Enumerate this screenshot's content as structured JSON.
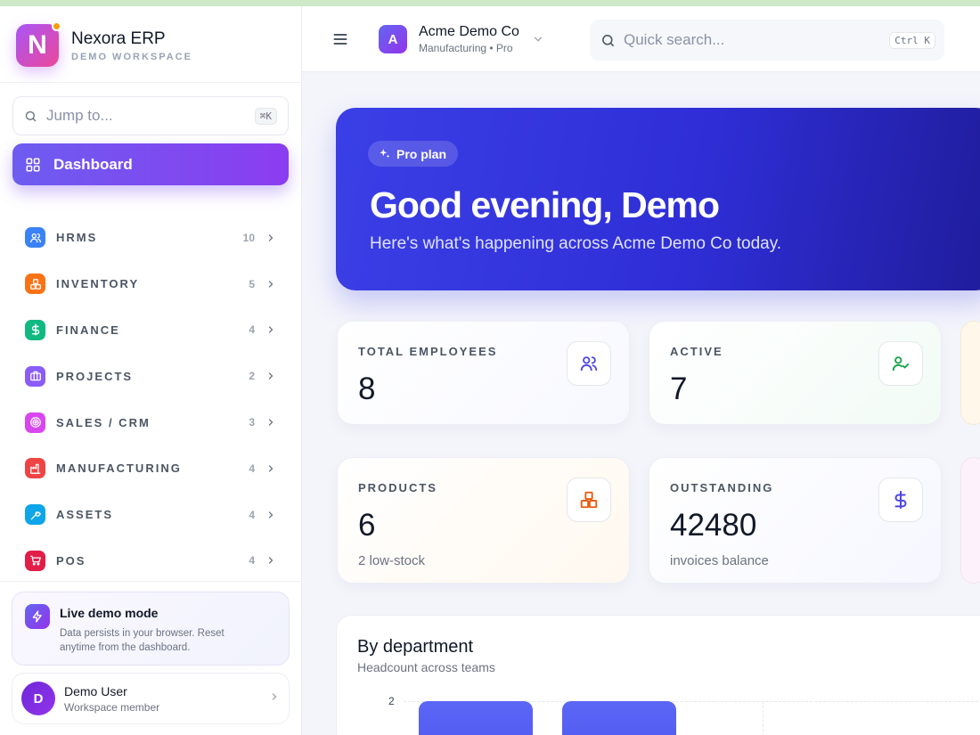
{
  "brand": {
    "name": "Nexora ERP",
    "subtitle": "DEMO WORKSPACE",
    "logo_letter": "N"
  },
  "jump": {
    "placeholder": "Jump to...",
    "shortcut": "⌘K"
  },
  "nav": {
    "dashboard_label": "Dashboard",
    "items": [
      {
        "label": "HRMS",
        "count": "10",
        "color": "#3b82f6",
        "icon": "users-icon"
      },
      {
        "label": "INVENTORY",
        "count": "5",
        "color": "#f97316",
        "icon": "boxes-icon"
      },
      {
        "label": "FINANCE",
        "count": "4",
        "color": "#10b981",
        "icon": "dollar-icon"
      },
      {
        "label": "PROJECTS",
        "count": "2",
        "color": "#8b5cf6",
        "icon": "briefcase-icon"
      },
      {
        "label": "SALES / CRM",
        "count": "3",
        "color": "#d946ef",
        "icon": "target-icon"
      },
      {
        "label": "MANUFACTURING",
        "count": "4",
        "color": "#ef4444",
        "icon": "factory-icon"
      },
      {
        "label": "ASSETS",
        "count": "4",
        "color": "#0ea5e9",
        "icon": "wrench-icon"
      },
      {
        "label": "POS",
        "count": "4",
        "color": "#e11d48",
        "icon": "cart-icon"
      }
    ]
  },
  "demo_card": {
    "title": "Live demo mode",
    "description": "Data persists in your browser. Reset anytime from the dashboard."
  },
  "user": {
    "initial": "D",
    "name": "Demo User",
    "role": "Workspace member"
  },
  "header": {
    "org_initial": "A",
    "org_name": "Acme Demo Co",
    "org_sub": "Manufacturing • Pro",
    "search_placeholder": "Quick search...",
    "search_shortcut": "Ctrl K"
  },
  "hero": {
    "badge": "Pro plan",
    "title": "Good evening, Demo",
    "subtitle": "Here's what's happening across Acme Demo Co today."
  },
  "stats": [
    {
      "label": "TOTAL EMPLOYEES",
      "value": "8",
      "sub": "",
      "icon": "users-icon",
      "icon_color": "#4f46e5"
    },
    {
      "label": "ACTIVE",
      "value": "7",
      "sub": "",
      "icon": "user-check-icon",
      "icon_color": "#16a34a"
    },
    {
      "label": "PRODUCTS",
      "value": "6",
      "sub": "2 low-stock",
      "icon": "boxes-icon",
      "icon_color": "#ea580c"
    },
    {
      "label": "OUTSTANDING",
      "value": "42480",
      "sub": "invoices balance",
      "icon": "dollar-icon",
      "icon_color": "#4f46e5"
    }
  ],
  "department_panel": {
    "title": "By department",
    "subtitle": "Headcount across teams",
    "y_tick": "2"
  }
}
